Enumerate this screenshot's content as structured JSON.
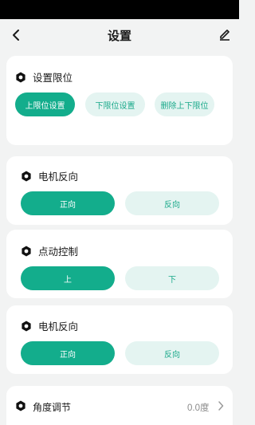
{
  "header": {
    "title": "设置"
  },
  "limit_section": {
    "title": "设置限位",
    "buttons": [
      "上限位设置",
      "下限位设置",
      "删除上下限位"
    ]
  },
  "motor_section_1": {
    "title": "电机反向",
    "options": [
      "正向",
      "反向"
    ]
  },
  "jog_section": {
    "title": "点动控制",
    "options": [
      "上",
      "下"
    ]
  },
  "motor_section_2": {
    "title": "电机反向",
    "options": [
      "正向",
      "反向"
    ]
  },
  "angle_row": {
    "label": "角度调节",
    "value": "0.0度"
  },
  "colors": {
    "accent": "#13ad8c",
    "accent_light": "#e4f4f1",
    "background": "#f2f3f3"
  },
  "icons": {
    "back": "chevron-left",
    "edit": "pencil",
    "section": "hexagon-nut",
    "more": "chevron-right"
  }
}
